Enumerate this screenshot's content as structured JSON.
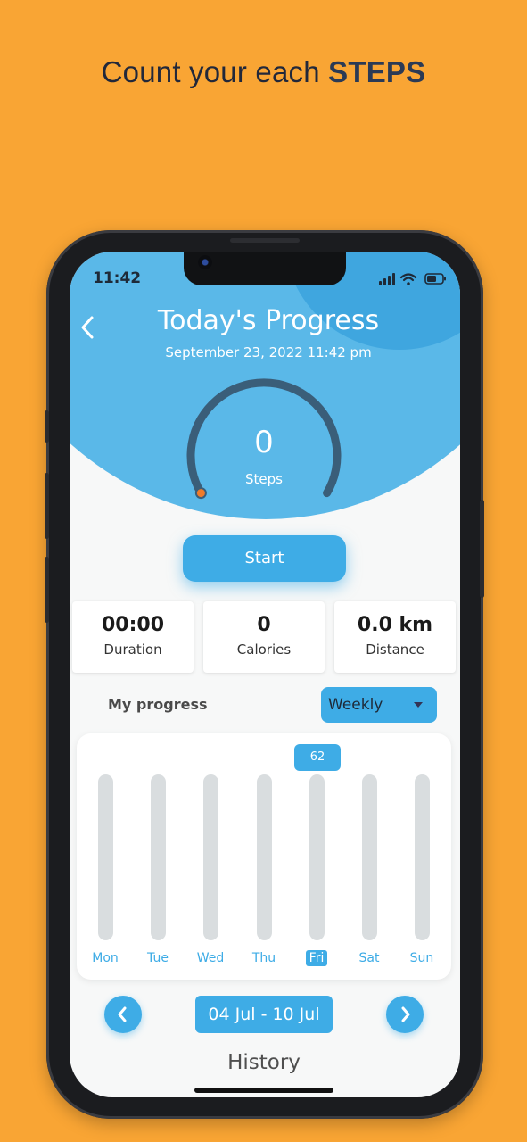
{
  "headline": {
    "prefix": "Count your each ",
    "emphasis": "STEPS"
  },
  "status_bar": {
    "time": "11:42"
  },
  "header": {
    "title": "Today's Progress",
    "date": "September 23, 2022 11:42 pm"
  },
  "gauge": {
    "value": "0",
    "label": "Steps",
    "progress_fraction": 0.0
  },
  "start_button": {
    "label": "Start"
  },
  "stats": [
    {
      "value": "00:00",
      "label": "Duration"
    },
    {
      "value": "0",
      "label": "Calories"
    },
    {
      "value": "0.0 km",
      "label": "Distance"
    }
  ],
  "progress": {
    "title": "My progress",
    "period_selected": "Weekly"
  },
  "chart_data": {
    "type": "bar",
    "categories": [
      "Mon",
      "Tue",
      "Wed",
      "Thu",
      "Fri",
      "Sat",
      "Sun"
    ],
    "values": [
      0,
      0,
      0,
      0,
      62,
      0,
      0
    ],
    "selected_category": "Fri",
    "tooltip": "62"
  },
  "week_nav": {
    "range": "04 Jul - 10 Jul"
  },
  "history": {
    "label": "History"
  },
  "colors": {
    "accent": "#3EACE6",
    "background": "#F9A534",
    "header": "#5AB8E8",
    "marker": "#F07B2A"
  }
}
